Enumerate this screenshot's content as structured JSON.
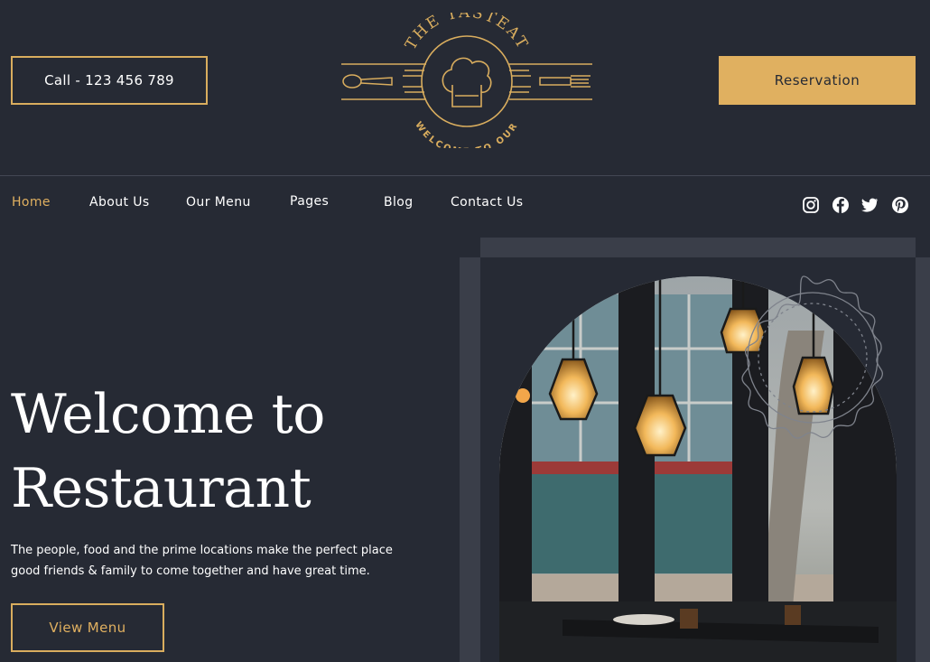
{
  "header": {
    "call_label": "Call - 123 456 789",
    "reservation_label": "Reservation",
    "logo": {
      "top_text": "THE TASTEAT",
      "bottom_text": "WELCOME TO OUR"
    }
  },
  "nav": {
    "items": [
      {
        "label": "Home",
        "active": true
      },
      {
        "label": "About Us",
        "active": false
      },
      {
        "label": "Our Menu",
        "active": false
      },
      {
        "label": "Pages",
        "active": false
      },
      {
        "label": "Blog",
        "active": false
      },
      {
        "label": "Contact Us",
        "active": false
      }
    ],
    "social": [
      "instagram-icon",
      "facebook-icon",
      "twitter-icon",
      "pinterest-icon"
    ]
  },
  "hero": {
    "title_line1": "Welcome to",
    "title_line2": "Restaurant",
    "text_line1": "The people, food and the prime locations make the perfect place",
    "text_line2": "good friends & family to come together and have great time.",
    "button_label": "View Menu"
  },
  "colors": {
    "background": "#262a34",
    "accent": "#e0b060",
    "frame": "#3a3e49",
    "text": "#ffffff"
  }
}
